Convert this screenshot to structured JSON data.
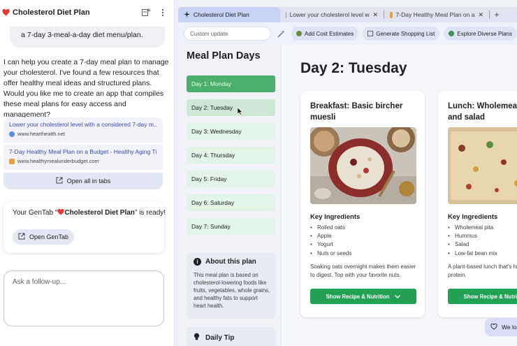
{
  "chat": {
    "title": "Cholesterol Diet Plan",
    "user_message": "a 7-day 3-meal-a-day diet menu/plan.",
    "assistant_message": "I can help you create a 7-day meal plan to manage your cholesterol. I've found a few resources that offer healthy meal ideas and structured plans. Would you like me to create an app that compiles these meal plans for easy access and management?",
    "sources": [
      {
        "title": "Lower your cholesterol level with a considered 7-day m...",
        "url": "www.hearthealth.net",
        "favicon_color": "#5b8def"
      },
      {
        "title": "7-Day Healthy Meal Plan on a Budget - Healthy Aging Ti...",
        "url": "www.healthymealunderbudget.com",
        "favicon_color": "#e8a23a"
      }
    ],
    "open_all_tabs_label": "Open all in tabs",
    "gentab_prefix": "Your GenTab \"",
    "gentab_name": "Cholesterol Diet Plan",
    "gentab_suffix": "\" is ready!",
    "open_gentab_label": "Open GenTab",
    "followup_placeholder": "Ask a follow-up..."
  },
  "browser": {
    "tabs": [
      {
        "label": "Cholesterol Diet Plan",
        "active": true,
        "icon": "sparkle-icon"
      },
      {
        "label": "Lower your cholesterol level w",
        "active": false,
        "icon": "globe-icon"
      },
      {
        "label": "7-Day Healthy Meal Plan on a",
        "active": false,
        "icon": "food-icon"
      }
    ],
    "toolbar": {
      "custom_update_placeholder": "Custom update",
      "chips": [
        "Add Cost Estimates",
        "Generate Shopping List",
        "Explore Diverse Plans"
      ]
    }
  },
  "app": {
    "sidebar_title": "Meal Plan Days",
    "days": [
      "Day 1: Monday",
      "Day 2: Tuesday",
      "Day 3: Wednesday",
      "Day 4: Thursday",
      "Day 5: Friday",
      "Day 6: Saturday",
      "Day 7: Sunday"
    ],
    "about_title": "About this plan",
    "about_text": "This meal plan is based on cholesterol-lowering foods like fruits, vegetables, whole grains, and healthy fats to support heart health.",
    "tip_title": "Daily Tip",
    "day_heading": "Day 2: Tuesday",
    "ingredients_label": "Key Ingredients",
    "recipe_button": "Show Recipe & Nutrition",
    "meals": [
      {
        "title": "Breakfast: Basic bircher muesli",
        "ingredients": [
          "Rolled oats",
          "Apple",
          "Yogurt",
          "Nuts or seeds"
        ],
        "description": "Soaking oats overnight makes them easier to digest. Top with your favorite nuts."
      },
      {
        "title": "Lunch: Wholemeal hummus and salad",
        "ingredients": [
          "Wholemeal pita",
          "Hummus",
          "Salad",
          "Low-fat bean mix"
        ],
        "description": "A plant-based lunch that's high in fiber and protein."
      }
    ],
    "feedback_label": "We lov",
    "colors": {
      "accent_green": "#4caf6e",
      "button_green": "#22a053",
      "active_tab": "#c7d4f5"
    }
  }
}
